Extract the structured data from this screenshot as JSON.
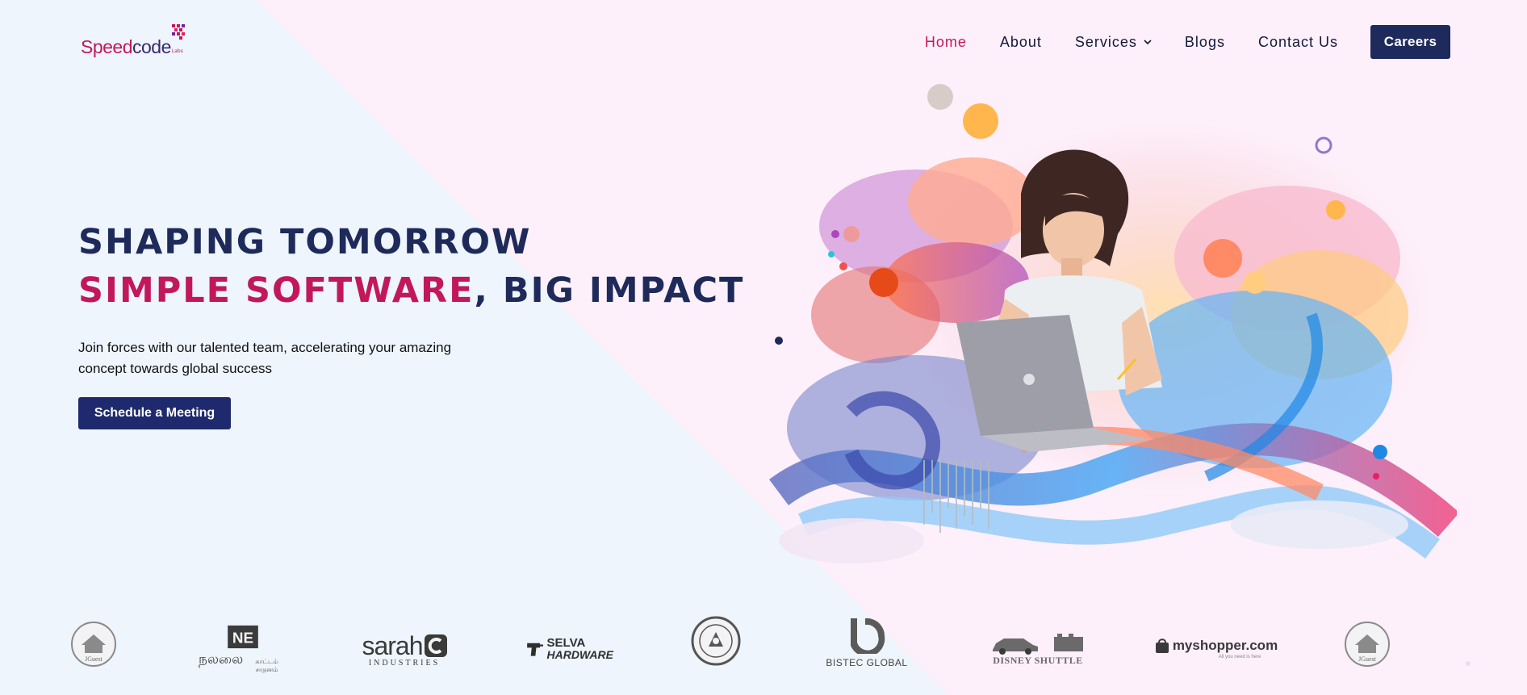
{
  "brand": {
    "name_part1": "Speed",
    "name_part2": "code",
    "name_suffix": "Labs",
    "primary_color": "#c2185b",
    "navy_color": "#1f2a5c"
  },
  "nav": {
    "items": [
      {
        "label": "Home",
        "active": true
      },
      {
        "label": "About"
      },
      {
        "label": "Services",
        "has_dropdown": true
      },
      {
        "label": "Blogs"
      },
      {
        "label": "Contact Us"
      }
    ],
    "careers_label": "Careers"
  },
  "hero": {
    "line1": "SHAPING TOMORROW",
    "line2_highlight": "SIMPLE SOFTWARE",
    "line2_rest": ", BIG IMPACT",
    "subtitle": "Join forces with our talented team, accelerating your amazing concept towards global success",
    "cta_label": "Schedule a Meeting"
  },
  "clients": [
    {
      "name": "JGuest",
      "text": "JGuest",
      "icon": "house-circle-icon"
    },
    {
      "name": "Nalai",
      "text": "நலலை",
      "subtext": "காட்டம் சாதனம்",
      "icon": "ne-monogram-icon"
    },
    {
      "name": "Sarah Industries",
      "text": "sarah",
      "subtext": "INDUSTRIES",
      "icon": "sarah-c-icon"
    },
    {
      "name": "Selva Hardware",
      "text": "SELVA",
      "subtext": "HARDWARE",
      "icon": "drill-icon"
    },
    {
      "name": "Seal",
      "text": "",
      "icon": "seal-emblem-icon"
    },
    {
      "name": "Bistec Global",
      "text": "BISTEC GLOBAL",
      "icon": "bistec-b-icon"
    },
    {
      "name": "Disney Shuttle",
      "text": "DISNEY SHUTTLE",
      "icon": "car-bus-icon"
    },
    {
      "name": "myshopper",
      "text": "myshopper.com",
      "subtext": "All you need is here",
      "icon": "shopper-bag-icon"
    },
    {
      "name": "JGuest repeat",
      "text": "JGuest",
      "icon": "house-circle-icon"
    }
  ]
}
